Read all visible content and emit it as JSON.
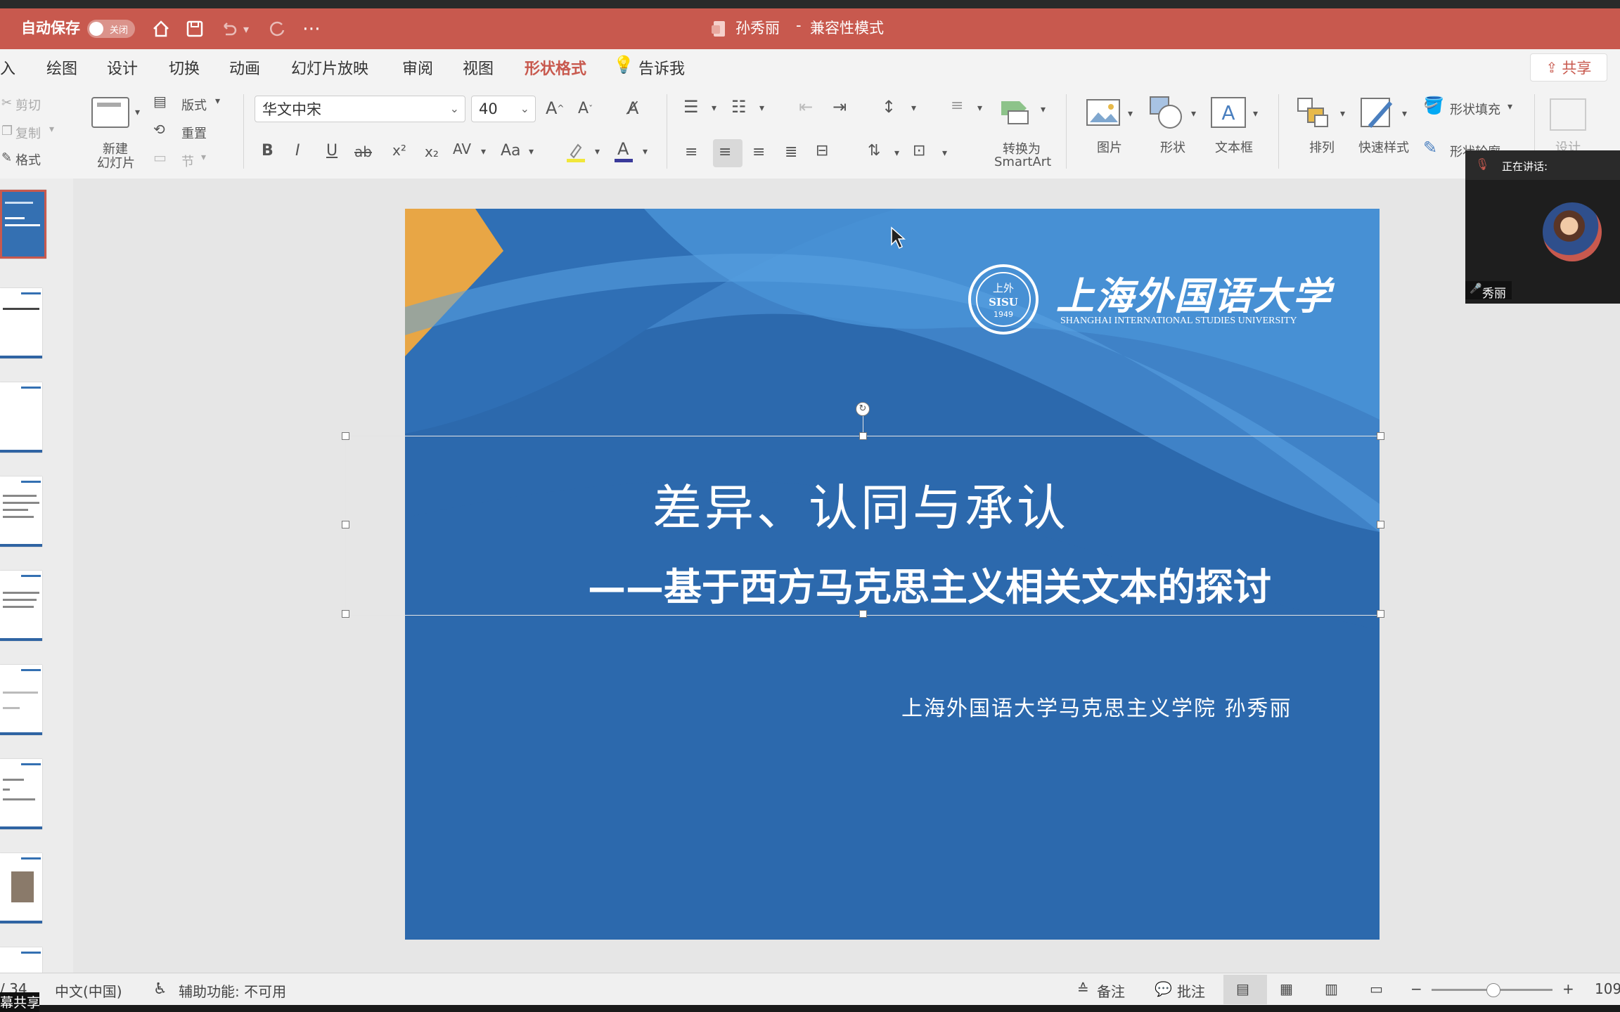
{
  "titlebar": {
    "autosave_label": "自动保存",
    "autosave_state": "关闭",
    "doc_title": "孙秀丽",
    "separator": "-",
    "mode": "兼容性模式"
  },
  "tabs": [
    "入",
    "绘图",
    "设计",
    "切换",
    "动画",
    "幻灯片放映",
    "审阅",
    "视图",
    "形状格式",
    "告诉我"
  ],
  "share_label": "共享",
  "clipboard": {
    "cut": "剪切",
    "copy": "复制",
    "format": "格式"
  },
  "slides_group": {
    "new_slide_line1": "新建",
    "new_slide_line2": "幻灯片",
    "layout": "版式",
    "reset": "重置",
    "section": "节"
  },
  "font": {
    "name": "华文中宋",
    "size": "40"
  },
  "format_buttons": {
    "bold": "B",
    "italic": "I",
    "underline": "U",
    "strike": "ab",
    "superscript": "x²",
    "subscript": "x₂",
    "spacing": "AV",
    "case": "Aa",
    "color_letter": "A"
  },
  "smartart": {
    "line1": "转换为",
    "line2": "SmartArt"
  },
  "insert_group": {
    "picture": "图片",
    "shape": "形状",
    "textbox": "文本框"
  },
  "arrange": {
    "arrange": "排列",
    "quick_styles": "快速样式",
    "fill": "形状填充",
    "outline": "形状轮廓",
    "designer": "设计"
  },
  "slide": {
    "university_cn": "上海外国语大学",
    "university_en": "SHANGHAI INTERNATIONAL STUDIES UNIVERSITY",
    "seal_top": "上外",
    "seal_mid": "SISU",
    "seal_year": "1949",
    "title": "差异、认同与承认",
    "subtitle": "——基于西方马克思主义相关文本的探讨",
    "author": "上海外国语大学马克思主义学院  孙秀丽"
  },
  "speaker": {
    "status": "正在讲话:",
    "name": "秀丽"
  },
  "status": {
    "slide_counter": "/ 34",
    "language": "中文(中国)",
    "accessibility": "辅助功能: 不可用",
    "notes": "备注",
    "comments": "批注",
    "zoom": "109",
    "screen_share": "幕共享"
  },
  "colors": {
    "accent": "#c8594e",
    "slide_blue": "#2c69ad",
    "slide_orange": "#e8a645"
  }
}
